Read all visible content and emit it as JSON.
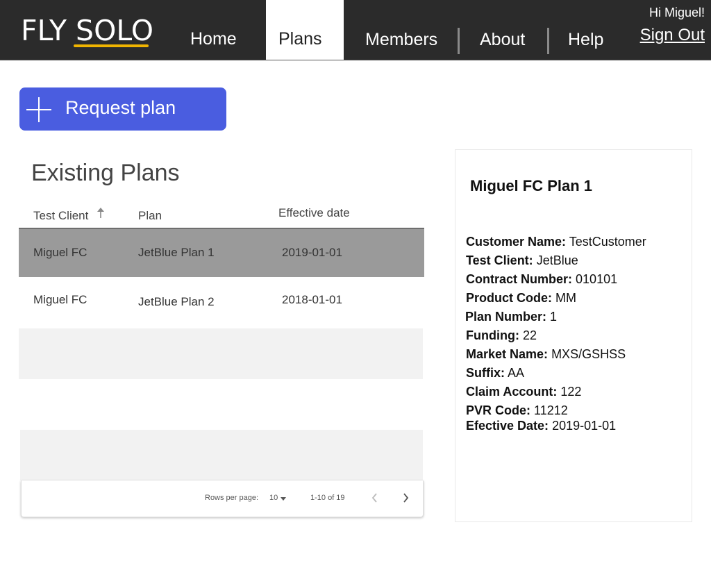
{
  "header": {
    "logo_text": "FLY SOLO",
    "nav": {
      "home": "Home",
      "plans": "Plans",
      "members": "Members",
      "about": "About",
      "help": "Help"
    },
    "greeting": "Hi Miguel!",
    "sign_out": "Sign Out"
  },
  "actions": {
    "request_plan": "Request plan"
  },
  "plans_table": {
    "title": "Existing Plans",
    "columns": {
      "client": "Test Client",
      "plan": "Plan",
      "effective_date": "Effective date"
    },
    "rows": [
      {
        "client": "Miguel FC",
        "plan": "JetBlue Plan 1",
        "effective_date": "2019-01-01",
        "selected": true
      },
      {
        "client": "Miguel FC",
        "plan": "JetBlue Plan 2",
        "effective_date": "2018-01-01",
        "selected": false
      }
    ],
    "pagination": {
      "rows_per_page_label": "Rows per page:",
      "rows_per_page_value": "10",
      "range": "1-10 of 19"
    }
  },
  "detail": {
    "title": "Miguel FC Plan 1",
    "fields": [
      {
        "key": "Customer Name:",
        "value": "TestCustomer"
      },
      {
        "key": "Test Client:",
        "value": "JetBlue"
      },
      {
        "key": "Contract Number:",
        "value": "010101"
      },
      {
        "key": "Product Code:",
        "value": "MM"
      },
      {
        "key": "Plan Number:",
        "value": "1"
      },
      {
        "key": "Funding:",
        "value": "22"
      },
      {
        "key": "Market Name:",
        "value": "MXS/GSHSS"
      },
      {
        "key": "Suffix:",
        "value": "AA"
      },
      {
        "key": "Claim Account:",
        "value": "122"
      },
      {
        "key": "PVR Code:",
        "value": "11212"
      },
      {
        "key": "Efective Date:",
        "value": " 2019-01-01"
      }
    ]
  },
  "colors": {
    "topbar": "#2b2b2b",
    "accent_button": "#4a5de0",
    "logo_underline": "#f0b400",
    "selected_row": "#9a9a9a",
    "striped_row": "#f2f2f2"
  },
  "icons": {
    "add": "plus-icon",
    "sort": "sort-ascending-icon",
    "prev": "chevron-left-icon",
    "next": "chevron-right-icon",
    "dropdown": "caret-down-icon"
  }
}
